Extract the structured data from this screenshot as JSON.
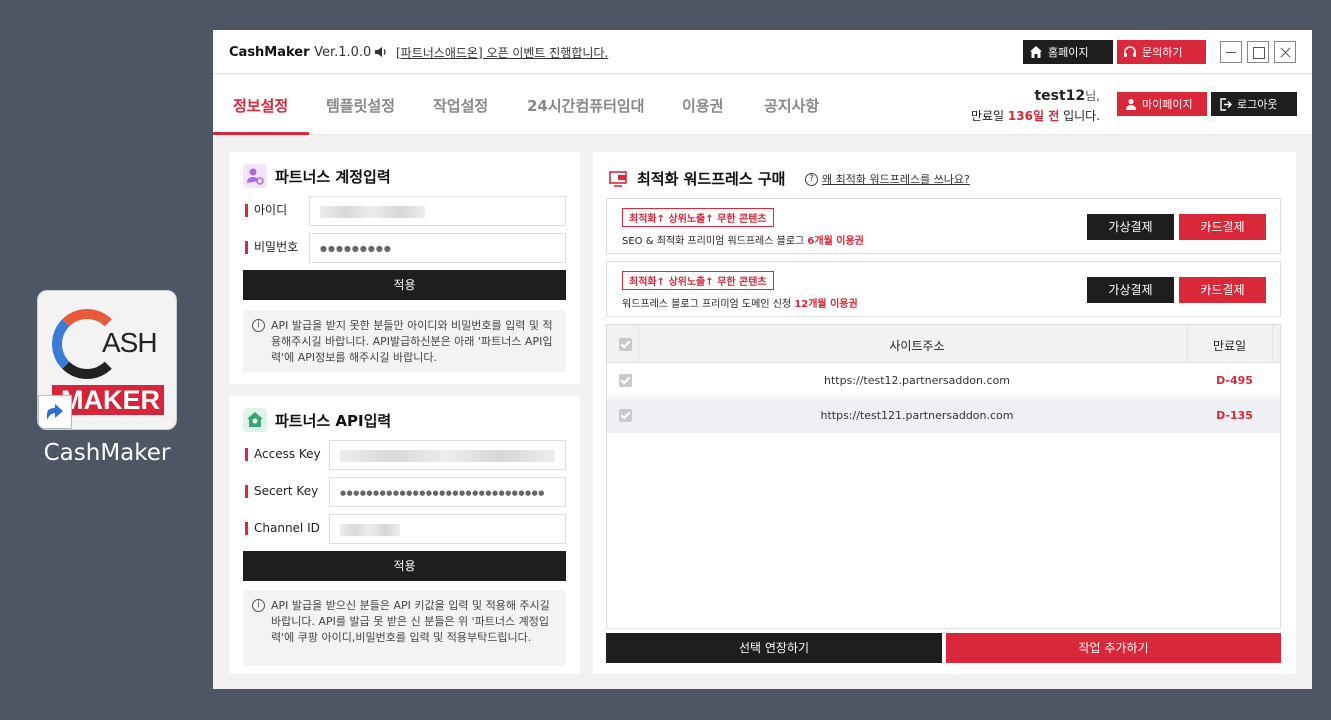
{
  "desktop": {
    "icon_label": "CashMaker",
    "logo_top": "ASH",
    "logo_bottom": "MAKER"
  },
  "titlebar": {
    "brand": "CashMaker",
    "version": "Ver.1.0.0",
    "notice": "[파트너스애드온] 오픈 이벤트 진행합니다.",
    "home_label": "홈페이지",
    "ask_label": "문의하기"
  },
  "nav": {
    "tabs": [
      "정보설정",
      "템플릿설정",
      "작업설정",
      "24시간컴퓨터임대",
      "이용권",
      "공지사항"
    ],
    "active_tab": 0
  },
  "user": {
    "name": "test12",
    "suffix": "님,",
    "expiry_prefix": "만료일",
    "expiry_days": "136일 전",
    "expiry_suffix": "입니다.",
    "mypage_label": "마이페이지",
    "logout_label": "로그아웃"
  },
  "account_panel": {
    "title": "파트너스 계정입력",
    "id_label": "아이디",
    "pw_label": "비밀번호",
    "pw_value": "●●●●●●●●●",
    "apply_label": "적용",
    "info": "API 발급을 받지 못한 분들만 아이디와 비밀번호를 입력 및 적용해주시길 바랍니다.  API발급하신분은 아래 '파트너스 API입력'에 API정보를 해주시길 바랍니다."
  },
  "api_panel": {
    "title": "파트너스 API입력",
    "access_label": "Access Key",
    "secret_label": "Secert Key",
    "secret_value": "●●●●●●●●●●●●●●●●●●●●●●●●●●●●●●●",
    "channel_label": "Channel ID",
    "apply_label": "적용",
    "info": "API 발급을 받으신 분들은 API 키값을 입력 및 적용해 주시길 바랍니다. API를 발급 못 받은 신 분들은 위 '파트너스 계정입력'에 쿠팡 아이디,비밀번호를 입력 및 적용부탁드립니다."
  },
  "wp_panel": {
    "title": "최적화 워드프레스 구매",
    "help": "왜 최적화 워드프레스를 쓰나요?",
    "offers": [
      {
        "tag": "최적화↑ 상위노출↑ 무한 콘텐츠",
        "desc": "SEO & 최적화 프리미엄 워드프레스 블로그",
        "period": "6개월 이용권",
        "virtual_label": "가상결제",
        "card_label": "카드결제"
      },
      {
        "tag": "최적화↑ 상위노출↑ 무한 콘텐츠",
        "desc": "워드프레스 블로그 프리미엄 도메인 신청",
        "period": "12개월 이용권",
        "virtual_label": "가상결제",
        "card_label": "카드결제"
      }
    ],
    "table": {
      "headers": [
        "사이트주소",
        "만료일"
      ],
      "rows": [
        {
          "url": "https://test12.partnersaddon.com",
          "expiry": "D-495"
        },
        {
          "url": "https://test121.partnersaddon.com",
          "expiry": "D-135"
        }
      ]
    },
    "extend_label": "선택 연장하기",
    "add_label": "작업 추가하기"
  },
  "colors": {
    "accent": "#d8283a",
    "dark": "#1e1e1e",
    "desktop_bg": "#4c5664"
  }
}
